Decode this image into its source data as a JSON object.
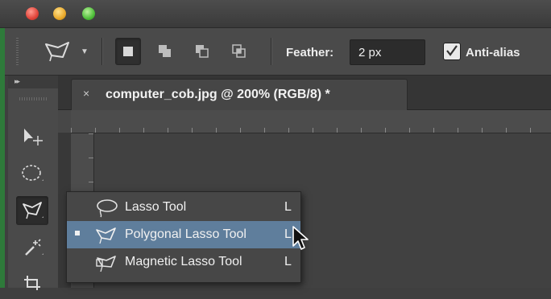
{
  "window": {
    "controls": [
      "close",
      "minimize",
      "zoom"
    ]
  },
  "options_bar": {
    "tool_preset_icon": "polygonal-lasso-icon",
    "selection_modes": [
      {
        "name": "new-selection",
        "icon": "new-selection-icon",
        "active": true
      },
      {
        "name": "add-to-selection",
        "icon": "add-selection-icon",
        "active": false
      },
      {
        "name": "subtract-from-selection",
        "icon": "subtract-selection-icon",
        "active": false
      },
      {
        "name": "intersect-with-selection",
        "icon": "intersect-selection-icon",
        "active": false
      }
    ],
    "feather_label": "Feather:",
    "feather_value": "2 px",
    "antialias_label": "Anti-alias",
    "antialias_checked": true
  },
  "toolbox": {
    "tools": [
      {
        "name": "move-tool",
        "icon": "move-icon"
      },
      {
        "name": "marquee-tool",
        "icon": "elliptical-marquee-icon"
      },
      {
        "name": "lasso-tool",
        "icon": "polygonal-lasso-icon",
        "selected": true
      },
      {
        "name": "magic-wand-tool",
        "icon": "magic-wand-icon"
      },
      {
        "name": "crop-tool",
        "icon": "crop-icon"
      }
    ]
  },
  "document_tab": {
    "close_glyph": "×",
    "title": "computer_cob.jpg @ 200% (RGB/8) *"
  },
  "lasso_flyout": {
    "items": [
      {
        "label": "Lasso Tool",
        "shortcut": "L",
        "icon": "lasso-icon",
        "active": false,
        "highlighted": false
      },
      {
        "label": "Polygonal Lasso Tool",
        "shortcut": "L",
        "icon": "polygonal-lasso-icon",
        "active": true,
        "highlighted": true
      },
      {
        "label": "Magnetic Lasso Tool",
        "shortcut": "L",
        "icon": "magnetic-lasso-icon",
        "active": false,
        "highlighted": false
      }
    ]
  },
  "colors": {
    "panel": "#4a4a4a",
    "canvas_bg": "#383838",
    "menu_highlight": "#5f7e9c"
  }
}
